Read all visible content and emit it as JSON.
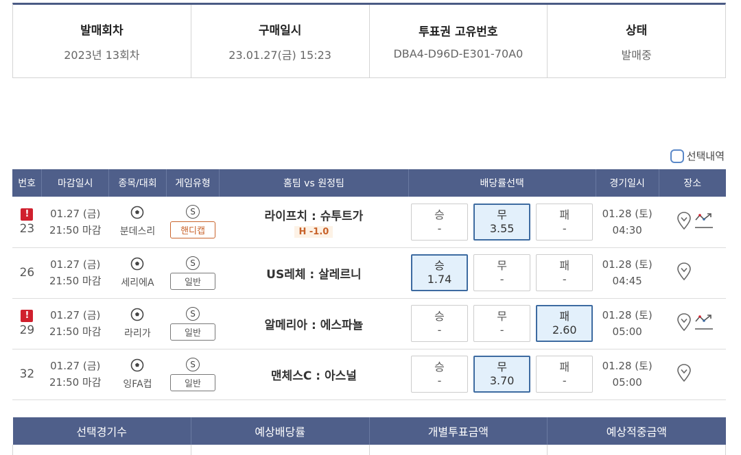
{
  "info": {
    "round_label": "발매회차",
    "round_value": "2023년 13회차",
    "purchase_label": "구매일시",
    "purchase_value": "23.01.27(금) 15:23",
    "ticket_label": "투표권 고유번호",
    "ticket_value": "DBA4-D96D-E301-70A0",
    "status_label": "상태",
    "status_value": "발매중"
  },
  "selection_history_label": "선택내역",
  "table": {
    "headers": [
      "번호",
      "마감일시",
      "종목/대회",
      "게임유형",
      "홈팀 vs 원정팀",
      "배당률선택",
      "경기일시",
      "장소"
    ],
    "rows": [
      {
        "no": "23",
        "alert": "!",
        "deadline_date": "01.27 (금)",
        "deadline_time": "21:50 마감",
        "league": "분데스리",
        "type_icon": "S",
        "type": "핸디캡",
        "handicap": true,
        "match": "라이프치 : 슈투트가",
        "handicap_value": "H -1.0",
        "win_label": "승",
        "win": "-",
        "draw_label": "무",
        "draw": "3.55",
        "lose_label": "패",
        "lose": "-",
        "selected": "draw",
        "game_date": "01.28 (토)",
        "game_time": "04:30",
        "trend": true
      },
      {
        "no": "26",
        "alert": "",
        "deadline_date": "01.27 (금)",
        "deadline_time": "21:50 마감",
        "league": "세리에A",
        "type_icon": "S",
        "type": "일반",
        "handicap": false,
        "match": "US레체 : 살레르니",
        "handicap_value": "",
        "win_label": "승",
        "win": "1.74",
        "draw_label": "무",
        "draw": "-",
        "lose_label": "패",
        "lose": "-",
        "selected": "win",
        "game_date": "01.28 (토)",
        "game_time": "04:45",
        "trend": false
      },
      {
        "no": "29",
        "alert": "!",
        "deadline_date": "01.27 (금)",
        "deadline_time": "21:50 마감",
        "league": "라리가",
        "type_icon": "S",
        "type": "일반",
        "handicap": false,
        "match": "알메리아 : 에스파뇰",
        "handicap_value": "",
        "win_label": "승",
        "win": "-",
        "draw_label": "무",
        "draw": "-",
        "lose_label": "패",
        "lose": "2.60",
        "selected": "lose",
        "game_date": "01.28 (토)",
        "game_time": "05:00",
        "trend": true
      },
      {
        "no": "32",
        "alert": "",
        "deadline_date": "01.27 (금)",
        "deadline_time": "21:50 마감",
        "league": "잉FA컵",
        "type_icon": "S",
        "type": "일반",
        "handicap": false,
        "match": "맨체스C : 아스널",
        "handicap_value": "",
        "win_label": "승",
        "win": "-",
        "draw_label": "무",
        "draw": "3.70",
        "lose_label": "패",
        "lose": "-",
        "selected": "draw",
        "game_date": "01.28 (토)",
        "game_time": "05:00",
        "trend": false
      }
    ]
  },
  "summary": {
    "headers": [
      "선택경기수",
      "예상배당률",
      "개별투표금액",
      "예상적중금액"
    ]
  },
  "colors": {
    "header": "#4f5f8a",
    "selected": "#e3f0fb",
    "alert": "#d0202e",
    "handicap": "#c8622a"
  },
  "icons": {
    "sport": "soccer-ball-icon",
    "location": "map-pin-icon",
    "trend": "trend-chart-icon"
  }
}
